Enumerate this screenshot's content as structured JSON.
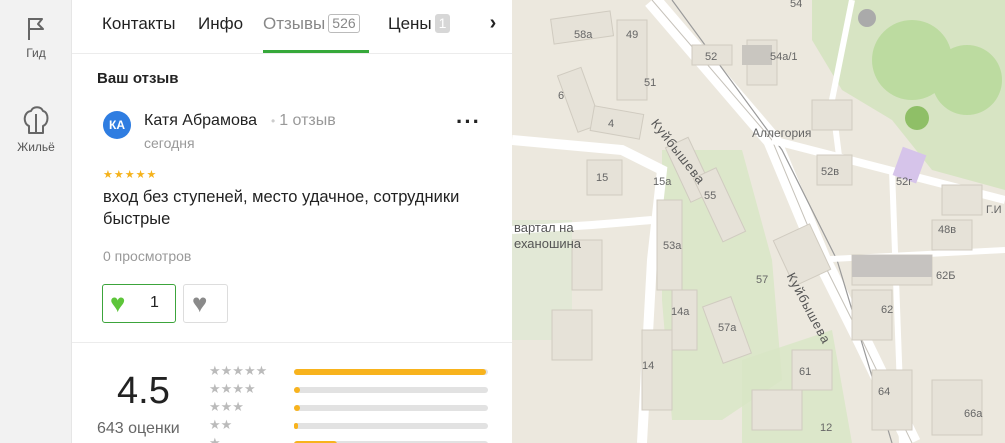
{
  "rail": {
    "guide": "Гид",
    "housing": "Жильё"
  },
  "tabs": {
    "contacts": "Контакты",
    "info": "Инфо",
    "reviews": "Отзывы",
    "reviews_count": "526",
    "prices": "Цены",
    "prices_count": "1"
  },
  "review": {
    "section_title": "Ваш отзыв",
    "avatar_initials": "КА",
    "author": "Катя Абрамова",
    "author_reviews": "1 отзыв",
    "date": "сегодня",
    "stars": 5,
    "text": "вход без ступеней, место удачное, сотрудники быстрые",
    "views": "0 просмотров",
    "likes": "1"
  },
  "rating": {
    "value": "4.5",
    "count_label": "643 оценки",
    "distribution": [
      0.99,
      0.03,
      0.03,
      0.02,
      0.22
    ]
  },
  "map": {
    "labels": [
      "54",
      "58а",
      "49",
      "52",
      "54а/1",
      "51",
      "6",
      "4",
      "Аллегория",
      "52в",
      "52г",
      "15",
      "15а",
      "55",
      "Г.И",
      "48в",
      "53а",
      "57",
      "62Б",
      "14а",
      "57а",
      "62",
      "14",
      "61",
      "64",
      "66а",
      "12"
    ],
    "place_name_line1": "вартал на",
    "place_name_line2": "еханошина",
    "street_name": "Куйбышева"
  },
  "colors": {
    "accent_green": "#36a83a",
    "star_yellow": "#f8b31d",
    "avatar_blue": "#2f7de1"
  }
}
